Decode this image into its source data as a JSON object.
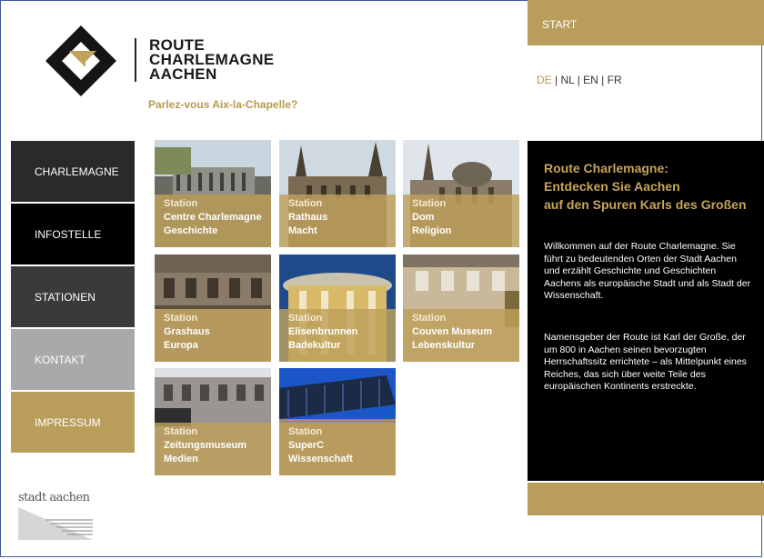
{
  "header": {
    "brand_lines": [
      "ROUTE",
      "CHARLEMAGNE",
      "AACHEN"
    ],
    "tagline": "Parlez-vous Aix-la-Chapelle?",
    "start_label": "START",
    "languages": [
      "DE",
      "NL",
      "EN",
      "FR"
    ],
    "active_language": "DE"
  },
  "nav": {
    "items": [
      {
        "label": "CHARLEMAGNE",
        "color": "#2a2a2a"
      },
      {
        "label": "INFOSTELLE",
        "color": "#000000"
      },
      {
        "label": "STATIONEN",
        "color": "#3a3a3a"
      },
      {
        "label": "KONTAKT",
        "color": "#a9a9a9"
      },
      {
        "label": "IMPRESSUM",
        "color": "#b99d5b"
      }
    ]
  },
  "stations": [
    {
      "line1": "Station",
      "line2": "Centre Charlemagne",
      "line3": "Geschichte"
    },
    {
      "line1": "Station",
      "line2": "Rathaus",
      "line3": "Macht"
    },
    {
      "line1": "Station",
      "line2": "Dom",
      "line3": "Religion"
    },
    {
      "line1": "Station",
      "line2": "Grashaus",
      "line3": "Europa"
    },
    {
      "line1": "Station",
      "line2": "Elisenbrunnen",
      "line3": "Badekultur"
    },
    {
      "line1": "Station",
      "line2": "Couven Museum",
      "line3": "Lebenskultur"
    },
    {
      "line1": "Station",
      "line2": "Zeitungsmuseum",
      "line3": "Medien"
    },
    {
      "line1": "Station",
      "line2": "SuperC",
      "line3": "Wissenschaft"
    }
  ],
  "info": {
    "heading_lines": [
      "Route Charlemagne:",
      "Entdecken Sie Aachen",
      "auf den Spuren Karls des Großen"
    ],
    "paragraph1": "Willkommen auf der Route Charlemagne. Sie führt zu bedeutenden Orten der Stadt Aachen und erzählt Geschichte und Geschichten Aachens als europäische Stadt und als Stadt der Wissenschaft.",
    "paragraph2": "Namensgeber der Route ist Karl der Große, der um 800 in Aachen seinen bevorzugten Herrschaftssitz errichtete – als Mittelpunkt eines Reiches, das sich über weite Teile des europäischen Kontinents erstreckte."
  },
  "footer": {
    "city_logo_text": "stadt aachen"
  },
  "colors": {
    "gold": "#b99d5b",
    "heading_gold": "#c7a45a",
    "dark": "#000000"
  }
}
